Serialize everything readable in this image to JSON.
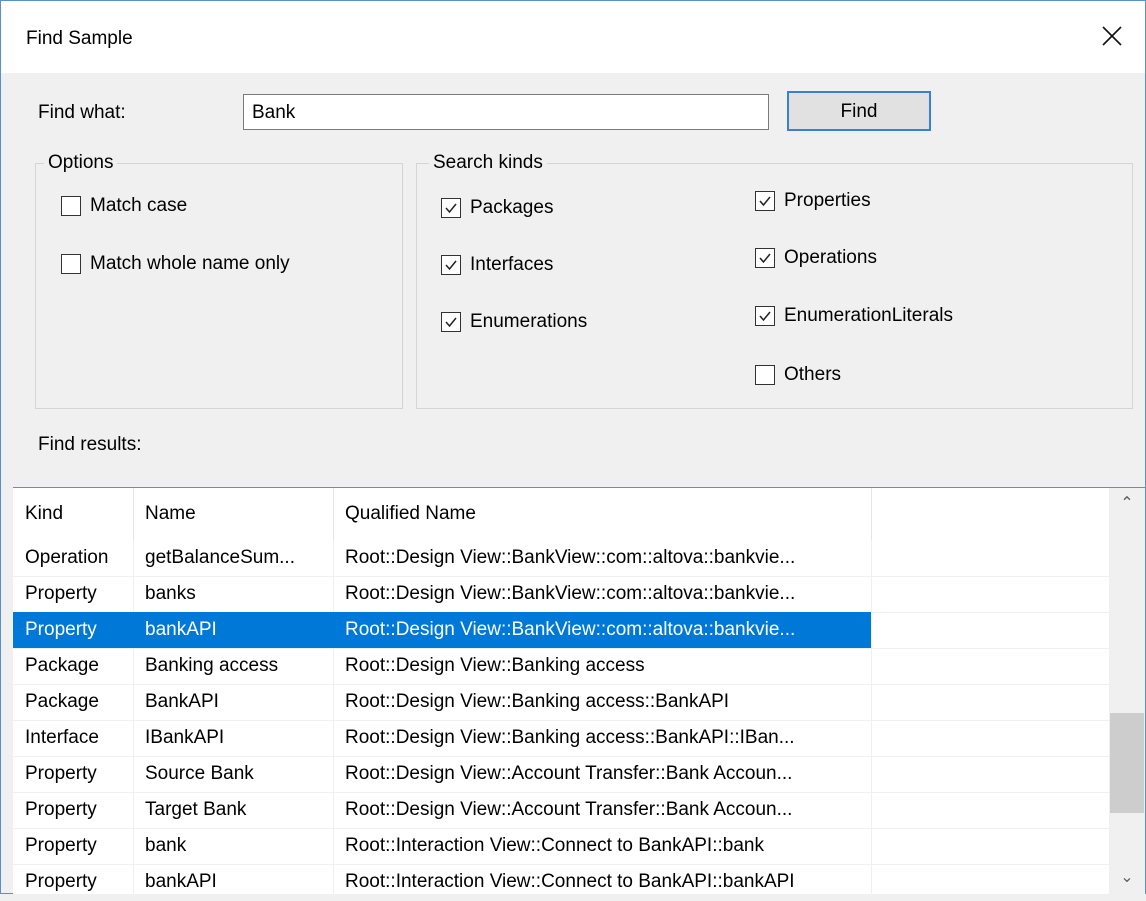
{
  "window": {
    "title": "Find Sample"
  },
  "search": {
    "label": "Find what:",
    "value": "Bank",
    "button_label": "Find"
  },
  "options": {
    "title": "Options",
    "items": [
      {
        "label": "Match case",
        "checked": false
      },
      {
        "label": "Match whole name only",
        "checked": false
      }
    ]
  },
  "search_kinds": {
    "title": "Search kinds",
    "items": [
      {
        "label": "Packages",
        "checked": true
      },
      {
        "label": "Interfaces",
        "checked": true
      },
      {
        "label": "Enumerations",
        "checked": true
      },
      {
        "label": "Properties",
        "checked": true
      },
      {
        "label": "Operations",
        "checked": true
      },
      {
        "label": "EnumerationLiterals",
        "checked": true
      },
      {
        "label": "Others",
        "checked": false
      }
    ]
  },
  "results": {
    "label": "Find results:",
    "columns": [
      "Kind",
      "Name",
      "Qualified Name"
    ],
    "selected_index": 2,
    "rows": [
      {
        "kind": "Operation",
        "name": "getBalanceSum...",
        "qualified": "Root::Design View::BankView::com::altova::bankvie..."
      },
      {
        "kind": "Property",
        "name": "banks",
        "qualified": "Root::Design View::BankView::com::altova::bankvie..."
      },
      {
        "kind": "Property",
        "name": "bankAPI",
        "qualified": "Root::Design View::BankView::com::altova::bankvie..."
      },
      {
        "kind": "Package",
        "name": "Banking access",
        "qualified": "Root::Design View::Banking access"
      },
      {
        "kind": "Package",
        "name": "BankAPI",
        "qualified": "Root::Design View::Banking access::BankAPI"
      },
      {
        "kind": "Interface",
        "name": "IBankAPI",
        "qualified": "Root::Design View::Banking access::BankAPI::IBan..."
      },
      {
        "kind": "Property",
        "name": "Source Bank",
        "qualified": "Root::Design View::Account Transfer::Bank Accoun..."
      },
      {
        "kind": "Property",
        "name": "Target Bank",
        "qualified": "Root::Design View::Account Transfer::Bank Accoun..."
      },
      {
        "kind": "Property",
        "name": "bank",
        "qualified": "Root::Interaction View::Connect to BankAPI::bank"
      },
      {
        "kind": "Property",
        "name": "bankAPI",
        "qualified": "Root::Interaction View::Connect to BankAPI::bankAPI"
      }
    ]
  },
  "colors": {
    "accent": "#0078d7",
    "button_border": "#3c7fd6"
  },
  "icons": {
    "close": "close-icon",
    "check": "checkmark-icon",
    "scroll_up": "chevron-up-icon",
    "scroll_down": "chevron-down-icon"
  }
}
